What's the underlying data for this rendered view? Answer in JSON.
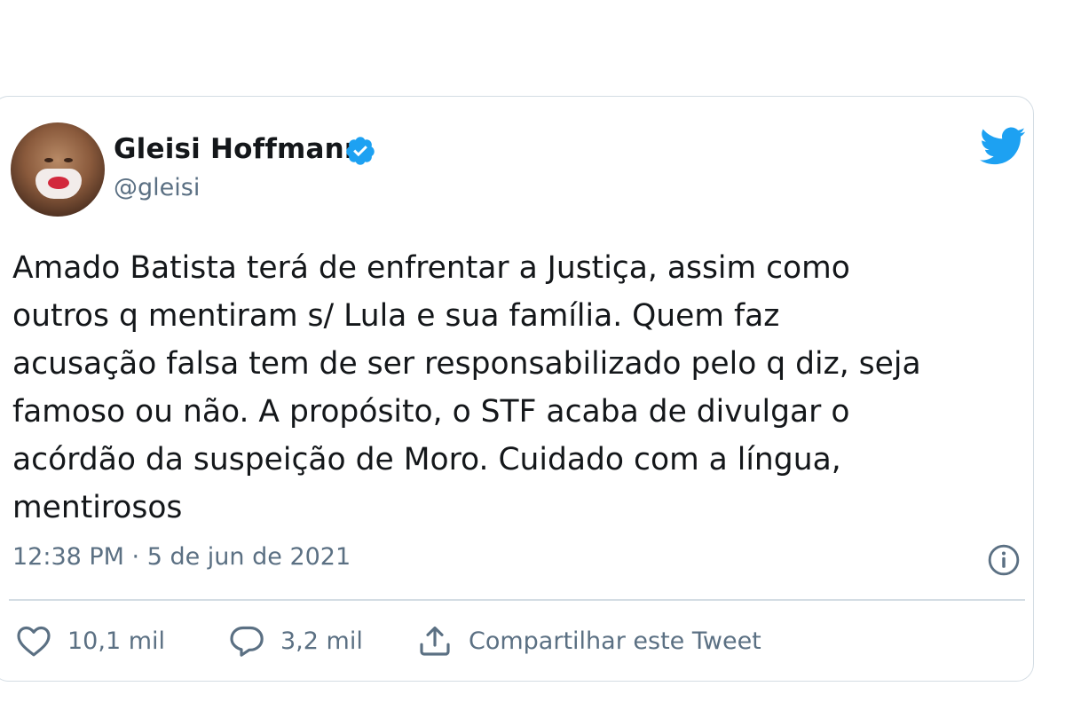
{
  "tweet": {
    "author": {
      "display_name": "Gleisi Hoffmann",
      "handle": "@gleisi",
      "verified": true,
      "verified_icon": "verified-badge-icon"
    },
    "brand_icon": "twitter-bird-icon",
    "text": "Amado Batista terá de enfrentar a Justiça, assim como\noutros q mentiram s/ Lula e sua família. Quem faz\nacusação falsa tem de ser responsabilizado pelo q diz, seja\nfamoso ou não. A propósito, o STF acaba de divulgar o\nacórdão da suspeição de Moro. Cuidado com a língua,\nmentirosos",
    "timestamp": "12:38 PM · 5 de jun de 2021",
    "info_icon": "info-icon",
    "actions": {
      "like": {
        "icon": "heart-icon",
        "count": "10,1 mil"
      },
      "reply": {
        "icon": "speech-bubble-icon",
        "count": "3,2 mil"
      },
      "share": {
        "icon": "share-icon",
        "label": "Compartilhar este Tweet"
      }
    }
  },
  "colors": {
    "brand": "#1da1f2",
    "text_primary": "#14171a",
    "text_secondary": "#5b7083",
    "border": "#d4dde4"
  }
}
